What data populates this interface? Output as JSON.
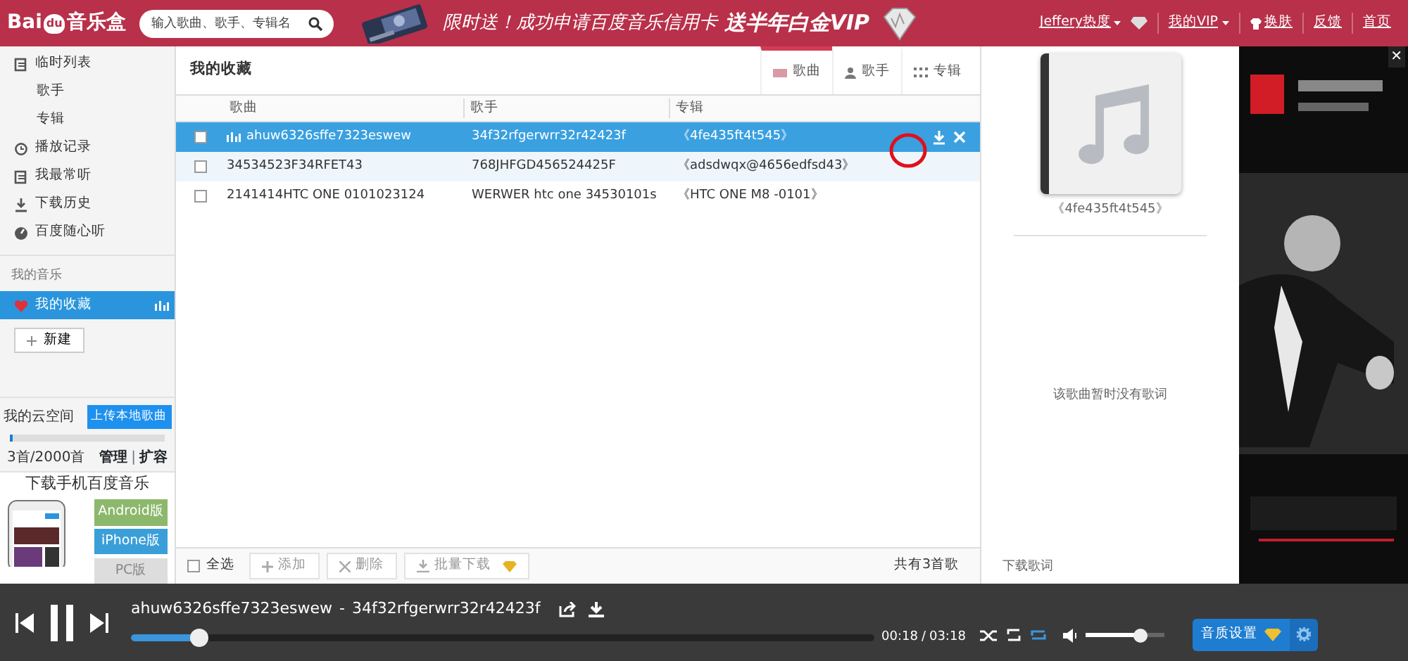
{
  "header": {
    "logo_left": "Bai",
    "logo_mark": "du",
    "logo_right": "音乐盒",
    "search": {
      "placeholder": "输入歌曲、歌手、专辑名"
    },
    "banner": {
      "text": "限时送！成功申请百度音乐信用卡",
      "highlight": "送半年白金VIP"
    },
    "nav": [
      {
        "label": "Jeffery热度",
        "kind": "user"
      },
      {
        "label": "我的VIP",
        "kind": "menu"
      },
      {
        "label": "换肤",
        "kind": "skin"
      },
      {
        "label": "反馈",
        "kind": "plain"
      },
      {
        "label": "首页",
        "kind": "plain"
      }
    ]
  },
  "sidebar": {
    "items": [
      {
        "label": "临时列表",
        "kind": "list",
        "children": [
          {
            "label": "歌手"
          },
          {
            "label": "专辑"
          }
        ]
      },
      {
        "label": "播放记录",
        "kind": "history"
      },
      {
        "label": "我最常听",
        "kind": "list"
      },
      {
        "label": "下载历史",
        "kind": "download"
      },
      {
        "label": "百度随心听",
        "kind": "radio"
      }
    ],
    "my_music": {
      "title": "我的音乐",
      "playlists": [
        {
          "label": "我的收藏",
          "selected": true
        }
      ],
      "new_button": "新建"
    },
    "cloud": {
      "title": "我的云空间",
      "upload": "上传本地歌曲",
      "level": 0.02,
      "usage": "3首/2000首",
      "links": [
        "管理",
        "扩容"
      ],
      "link_separator": "|"
    },
    "mobile": {
      "title": "下载手机百度音乐",
      "buttons": [
        {
          "label": "Android版",
          "kind": "android"
        },
        {
          "label": "iPhone版",
          "kind": "iphone"
        },
        {
          "label": "PC版",
          "kind": "pc"
        }
      ]
    }
  },
  "main": {
    "title": "我的收藏",
    "views": [
      {
        "label": "歌曲",
        "kind": "song",
        "selected": true
      },
      {
        "label": "歌手",
        "kind": "artist",
        "selected": false
      },
      {
        "label": "专辑",
        "kind": "album",
        "selected": false
      }
    ],
    "columns": [
      "歌曲",
      "歌手",
      "专辑"
    ],
    "rows": [
      {
        "song": "ahuw6326sffe7323eswew",
        "artist": "34f32rfgerwrr32r42423f",
        "album": "《4fe435ft4t545》",
        "checked": false,
        "selected": true,
        "playing": true
      },
      {
        "song": "34534523F34RFET43",
        "artist": "768JHFGD456524425F",
        "album": "《adsdwqx@4656edfsd43》",
        "checked": false,
        "selected": false,
        "playing": false
      },
      {
        "song": "2141414HTC ONE 0101023124",
        "artist": "WERWER htc one 34530101s",
        "album": "《HTC ONE M8 -0101》",
        "checked": false,
        "selected": false,
        "playing": false
      }
    ],
    "footer": {
      "select_all": "全选",
      "checked": false,
      "actions": [
        {
          "label": "添加",
          "kind": "add"
        },
        {
          "label": "删除",
          "kind": "delete"
        },
        {
          "label": "批量下载",
          "kind": "download"
        }
      ],
      "count": "共有3首歌"
    }
  },
  "lyrics": {
    "album": "《4fe435ft4t545》",
    "message": "该歌曲暂时没有歌词",
    "download": "下载歌词"
  },
  "ad": {
    "kind": "picture",
    "close": "✕"
  },
  "player": {
    "title": "ahuw6326sffe7323eswew",
    "separator": "-",
    "artist": "34f32rfgerwrr32r42423f",
    "level": 0.09,
    "elapsed": "00:18",
    "divider": "/",
    "total": "03:18",
    "volume": {
      "level": 0.7
    },
    "quality": "音质设置"
  }
}
